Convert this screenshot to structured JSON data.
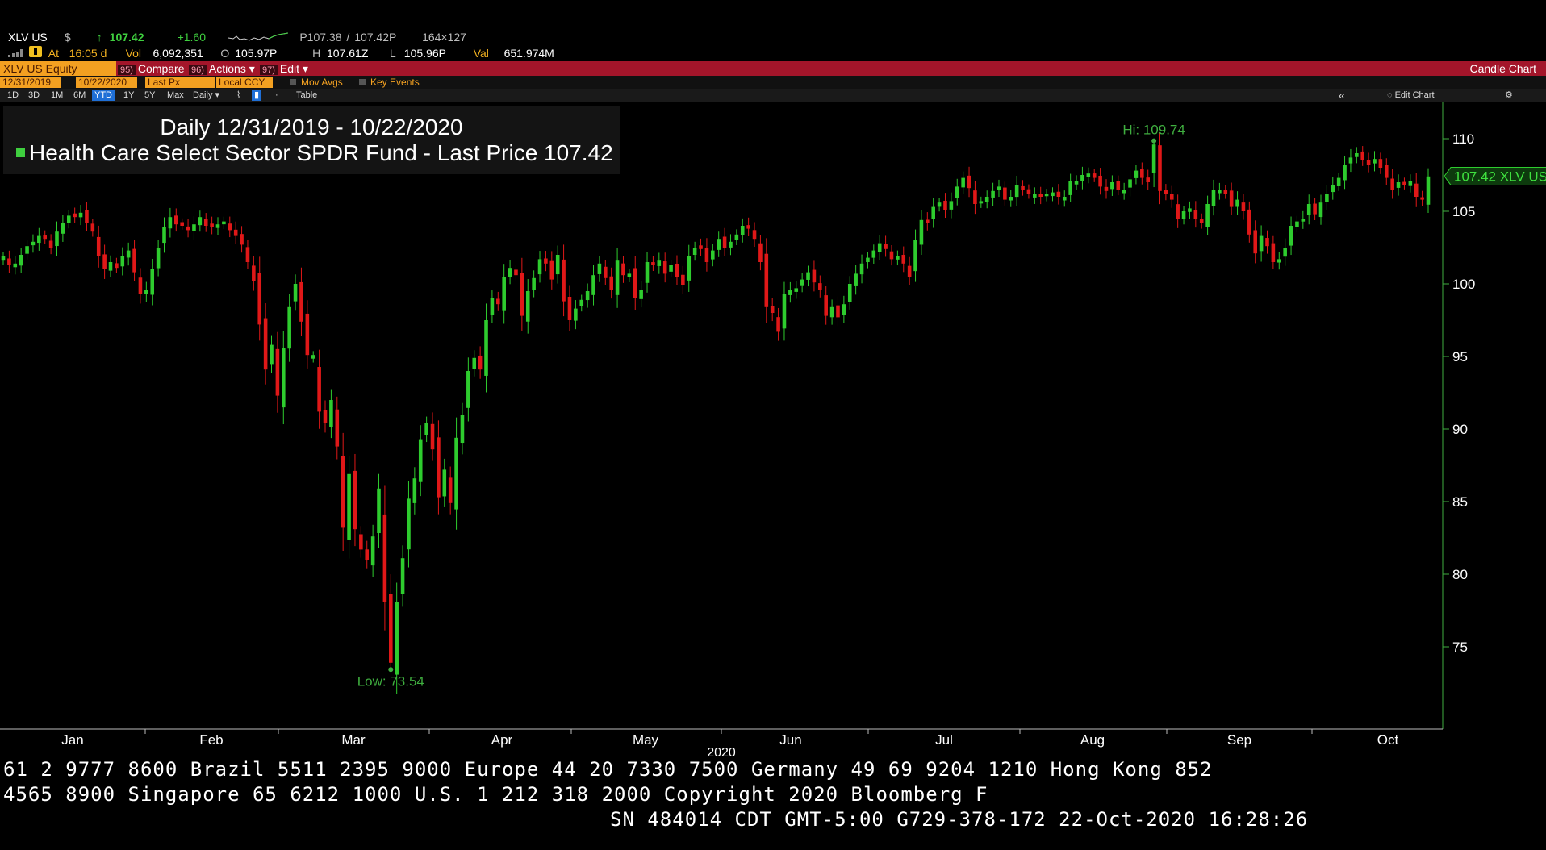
{
  "quote": {
    "ticker": "XLV US",
    "currency": "$",
    "arrow": "↑",
    "last": "107.42",
    "change": "+1.60",
    "bidask_p": "P107.38",
    "bidask_sep": "/",
    "ask": "107.42P",
    "size": "164×127",
    "at_label": "At",
    "at_time": "16:05 d",
    "vol_label": "Vol",
    "volume": "6,092,351",
    "open_label": "O",
    "open": "105.97P",
    "high_label": "H",
    "high": "107.61Z",
    "low_label": "L",
    "low": "105.96P",
    "val_label": "Val",
    "value": "651.974M"
  },
  "toolbar": {
    "equity": "XLV US Equity",
    "compare_num": "95)",
    "compare": "Compare",
    "actions_num": "96)",
    "actions": "Actions ▾",
    "edit_num": "97)",
    "edit": "Edit ▾",
    "chart_type": "Candle Chart"
  },
  "params": {
    "start": "12/31/2019",
    "end": "10/22/2020",
    "field": "Last Px",
    "ccy": "Local CCY",
    "mov_avgs": "Mov Avgs",
    "key_events": "Key Events"
  },
  "ranges": [
    "1D",
    "3D",
    "1M",
    "6M",
    "YTD",
    "1Y",
    "5Y",
    "Max"
  ],
  "range_active": "YTD",
  "period": "Daily ▾",
  "table_label": "Table",
  "edit_chart": "Edit Chart",
  "legend": {
    "line1": "Daily 12/31/2019 - 10/22/2020",
    "line2": "Health Care Select Sector SPDR Fund - Last Price 107.42"
  },
  "chart_data": {
    "type": "candlestick",
    "title": "Daily 12/31/2019 - 10/22/2020",
    "xlabel": "2020",
    "ylim": [
      68,
      112
    ],
    "yticks": [
      75,
      80,
      85,
      90,
      95,
      100,
      105,
      110
    ],
    "month_labels": [
      "Jan",
      "Feb",
      "Mar",
      "Apr",
      "May",
      "Jun",
      "Jul",
      "Aug",
      "Sep",
      "Oct"
    ],
    "hi_label": "Hi: 109.74",
    "low_label": "Low: 73.54",
    "hi_value": 109.74,
    "low_value": 73.54,
    "last_label": "107.42 XLV US",
    "last_value": 107.42,
    "colors": {
      "up": "#2ecc2e",
      "down": "#e01818",
      "axis": "#3fae3f"
    },
    "closes": [
      101.9,
      101.3,
      101.4,
      102.0,
      102.6,
      102.9,
      103.3,
      103.1,
      102.5,
      103.6,
      104.2,
      104.7,
      104.6,
      104.9,
      104.2,
      103.6,
      101.9,
      101.0,
      101.5,
      101.1,
      101.9,
      102.3,
      100.8,
      99.3,
      99.6,
      101.0,
      102.5,
      103.9,
      104.6,
      104.1,
      104.0,
      103.7,
      104.1,
      104.6,
      104.0,
      103.9,
      104.1,
      104.3,
      103.7,
      103.3,
      102.7,
      101.5,
      100.2,
      97.2,
      94.1,
      95.8,
      92.3,
      95.6,
      98.4,
      100.0,
      97.4,
      95.1,
      95.1,
      91.2,
      90.4,
      92.0,
      88.8,
      83.2,
      86.9,
      83.1,
      81.7,
      81.0,
      82.6,
      85.9,
      78.1,
      73.9,
      78.1,
      81.1,
      85.2,
      86.6,
      89.3,
      90.4,
      88.6,
      85.3,
      87.2,
      84.9,
      89.4,
      91.0,
      94.0,
      94.9,
      94.1,
      97.5,
      99.0,
      98.6,
      100.5,
      101.1,
      100.6,
      97.8,
      99.5,
      100.4,
      101.7,
      101.4,
      100.3,
      102.0,
      98.8,
      97.5,
      98.3,
      98.9,
      99.5,
      100.6,
      101.4,
      100.4,
      99.6,
      101.6,
      100.6,
      100.7,
      99.0,
      99.6,
      101.5,
      101.3,
      101.6,
      100.7,
      101.3,
      100.5,
      99.9,
      101.9,
      102.5,
      102.4,
      101.5,
      102.3,
      103.1,
      102.5,
      102.9,
      103.4,
      104.0,
      103.8,
      103.1,
      101.5,
      98.4,
      98.0,
      96.7,
      99.3,
      99.6,
      99.7,
      100.3,
      100.8,
      100.1,
      99.6,
      97.8,
      98.4,
      97.7,
      98.6,
      100.0,
      100.7,
      101.4,
      101.8,
      102.3,
      102.8,
      102.4,
      101.7,
      101.9,
      101.4,
      100.5,
      103.0,
      104.4,
      104.2,
      105.3,
      105.6,
      105.1,
      105.7,
      106.7,
      107.3,
      106.6,
      105.5,
      105.7,
      106.0,
      106.4,
      106.7,
      105.8,
      106.0,
      106.8,
      106.5,
      106.2,
      106.2,
      106.0,
      106.2,
      106.3,
      106.0,
      106.0,
      107.1,
      107.1,
      107.5,
      107.6,
      107.3,
      106.7,
      106.4,
      107.0,
      106.5,
      106.5,
      107.2,
      107.8,
      107.3,
      107.0,
      109.6,
      106.4,
      106.2,
      105.8,
      104.5,
      105.0,
      105.2,
      104.5,
      104.2,
      105.5,
      106.5,
      106.5,
      106.2,
      105.3,
      105.8,
      105.0,
      103.4,
      102.1,
      103.3,
      102.6,
      101.5,
      101.7,
      102.5,
      104.0,
      104.3,
      104.5,
      105.5,
      104.8,
      105.6,
      106.2,
      106.8,
      107.3,
      108.2,
      108.7,
      109.0,
      108.5,
      108.2,
      108.6,
      108.0,
      107.3,
      106.5,
      107.0,
      106.8,
      107.1,
      106.0,
      105.8,
      107.4
    ]
  },
  "footer": {
    "line1": "61 2 9777 8600 Brazil 5511 2395 9000 Europe 44 20 7330 7500 Germany 49 69 9204 1210 Hong Kong 852",
    "line2": "4565 8900        Singapore 65 6212 1000        U.S. 1 212 318 2000          Copyright 2020 Bloomberg F",
    "line3": "SN 484014 CDT  GMT-5:00 G729-378-172 22-Oct-2020 16:28:26"
  }
}
